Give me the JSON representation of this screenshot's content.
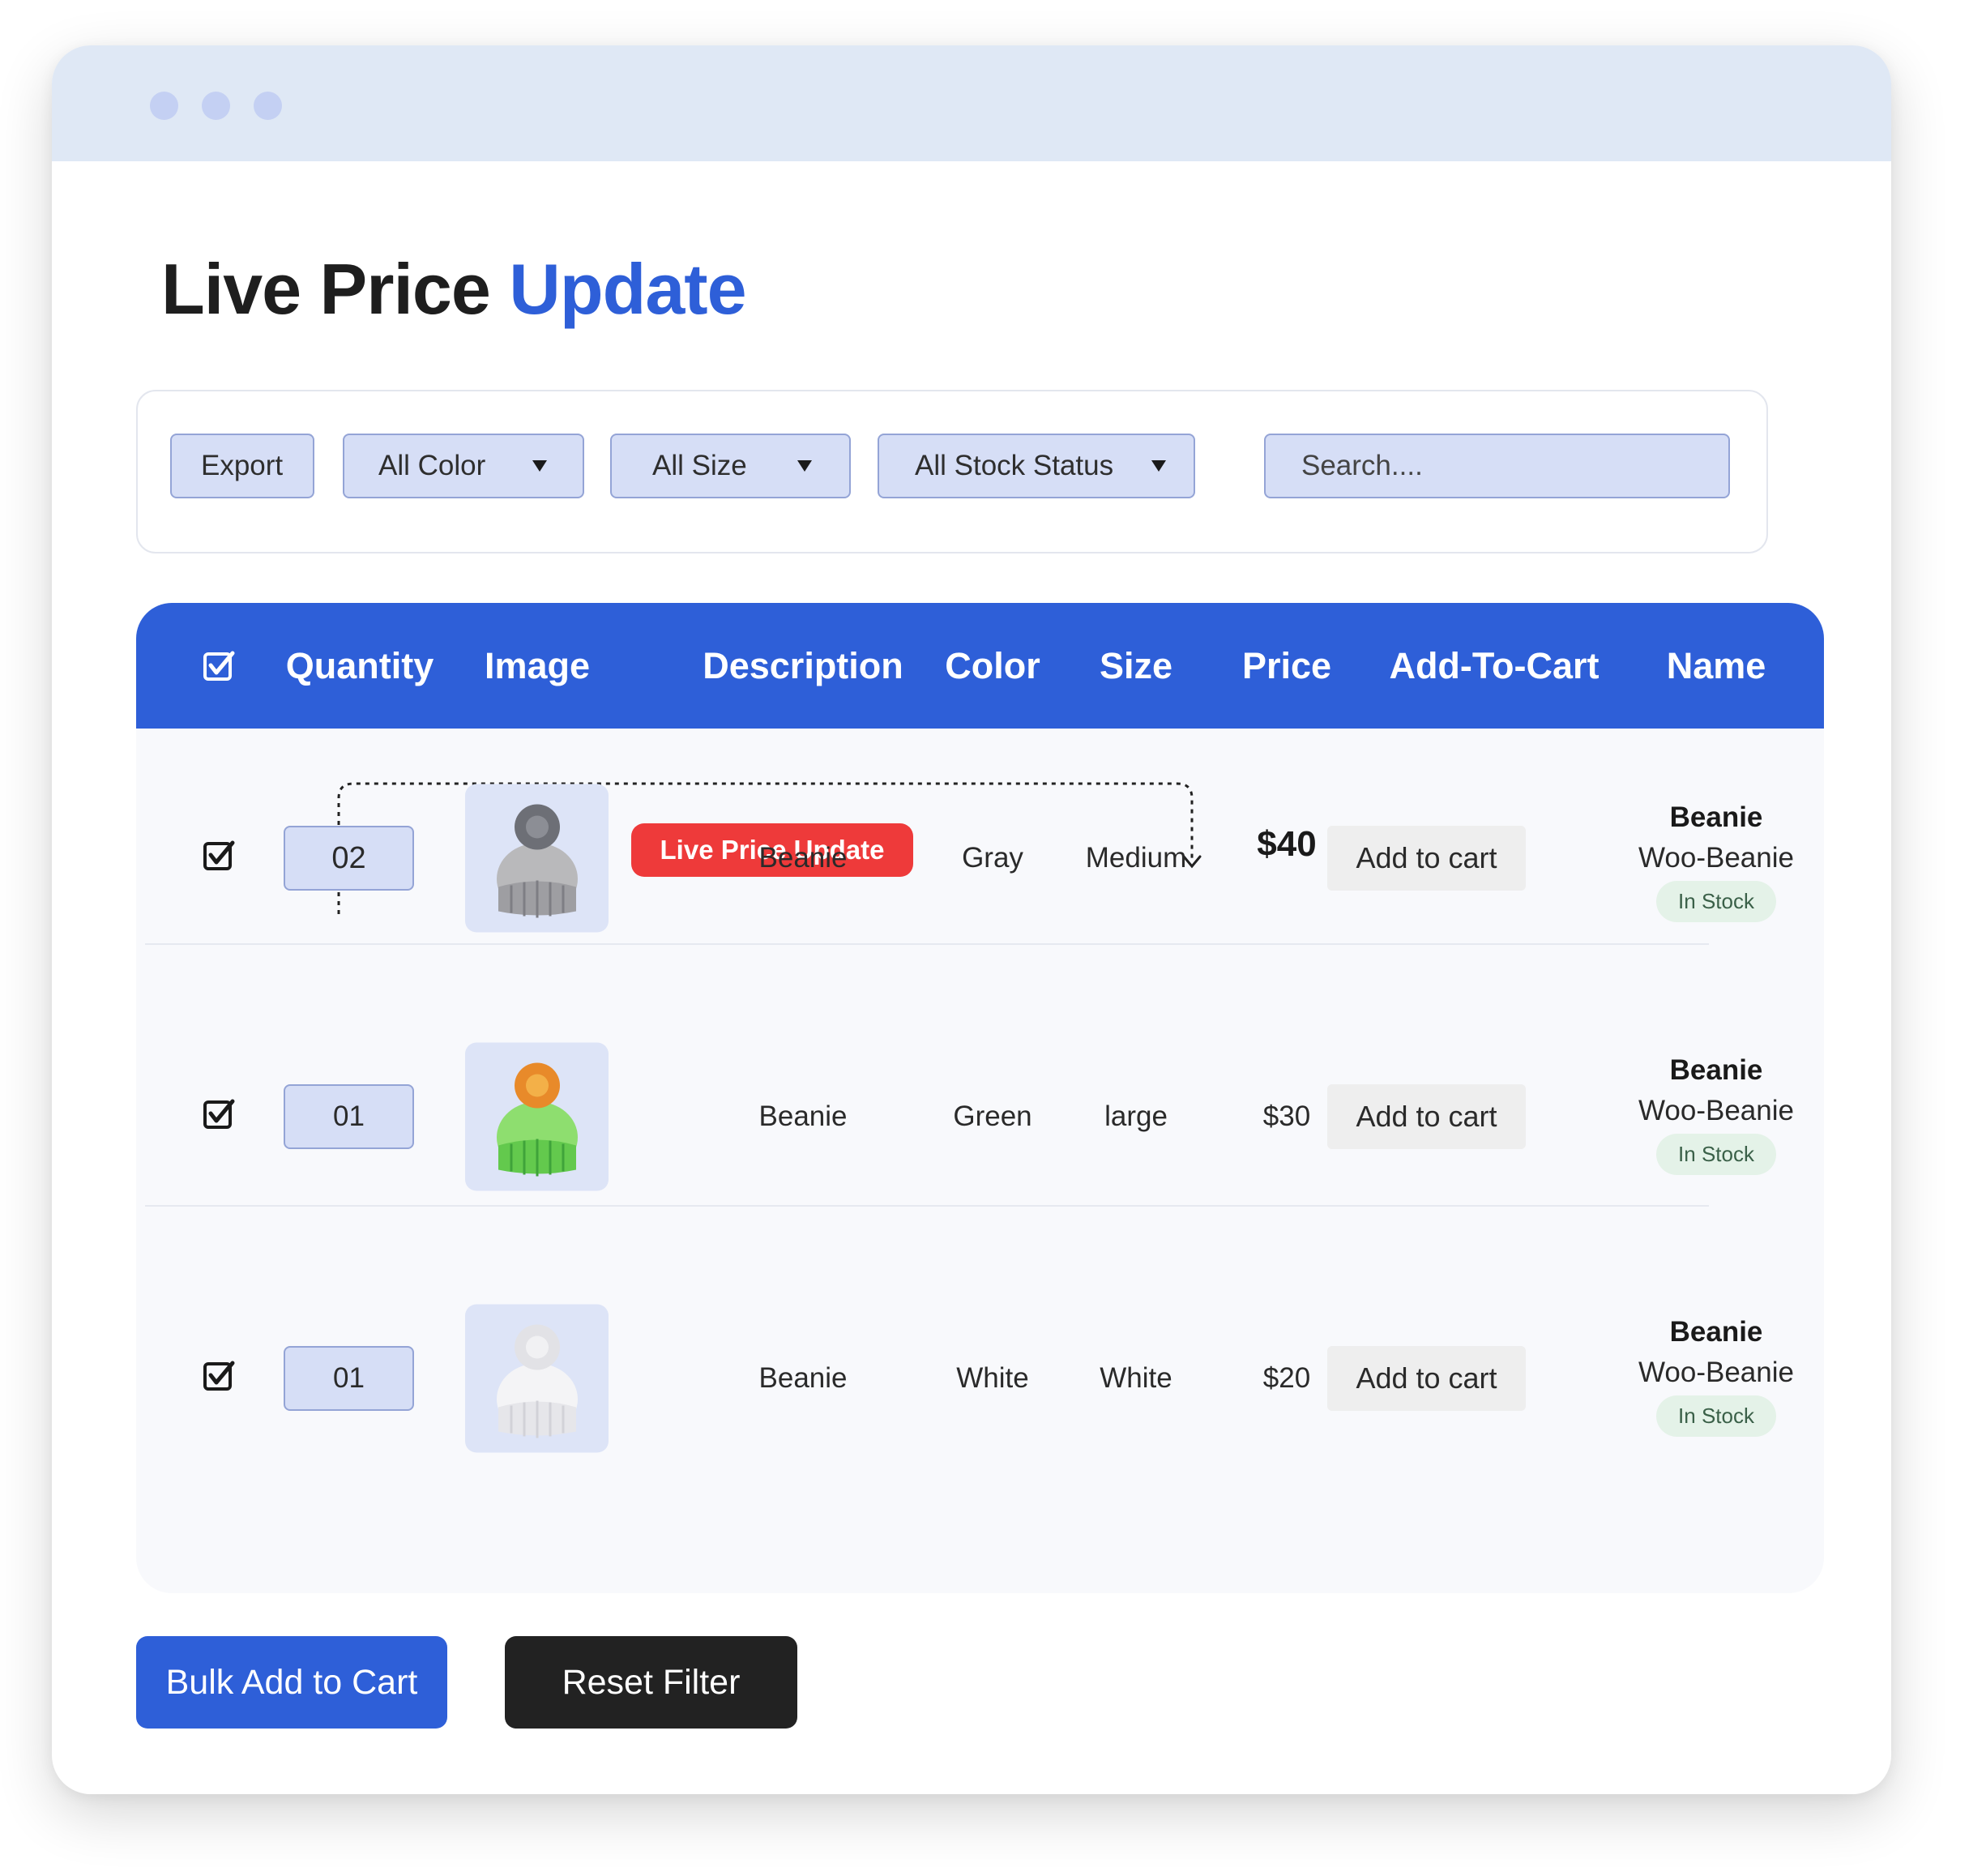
{
  "page": {
    "title_main": "Live Price Update",
    "title_lead": "Live Price",
    "title_accent": "Update"
  },
  "filters": {
    "export_label": "Export",
    "color_selected": "All Color",
    "size_selected": "All Size",
    "stock_selected": "All Stock Status",
    "search_placeholder": "Search...."
  },
  "table": {
    "headers": [
      "Quantity",
      "Image",
      "Description",
      "Color",
      "Size",
      "Price",
      "Add-To-Cart",
      "Name"
    ],
    "rows": [
      {
        "quantity": "02",
        "image_icon": "gray-beanie-image",
        "description": "Beanie",
        "color": "Gray",
        "size": "Medium",
        "price": "$40",
        "add_to_cart": "Add to cart",
        "name": "Beanie",
        "name_sub": "Woo-Beanie",
        "stock": "In Stock",
        "checked": true
      },
      {
        "quantity": "01",
        "image_icon": "green-beanie-image",
        "description": "Beanie",
        "color": "Green",
        "size": "large",
        "price": "$30",
        "add_to_cart": "Add to cart",
        "name": "Beanie",
        "name_sub": "Woo-Beanie",
        "stock": "In Stock",
        "checked": true
      },
      {
        "quantity": "01",
        "image_icon": "white-beanie-image",
        "description": "Beanie",
        "color": "White",
        "size": "White",
        "price": "$20",
        "add_to_cart": "Add to cart",
        "name": "Beanie",
        "name_sub": "Woo-Beanie",
        "stock": "In Stock",
        "checked": true
      }
    ]
  },
  "annotation": {
    "label": "Live Price Update"
  },
  "actions": {
    "bulk_label": "Bulk Add to Cart",
    "reset_label": "Reset Filter"
  },
  "colors": {
    "accent": "#2e5fd8",
    "titlebar": "#dfe8f5",
    "badge_red": "#ee3a3a",
    "stock_bg": "#e4f2e8",
    "dark_button": "#222222"
  }
}
